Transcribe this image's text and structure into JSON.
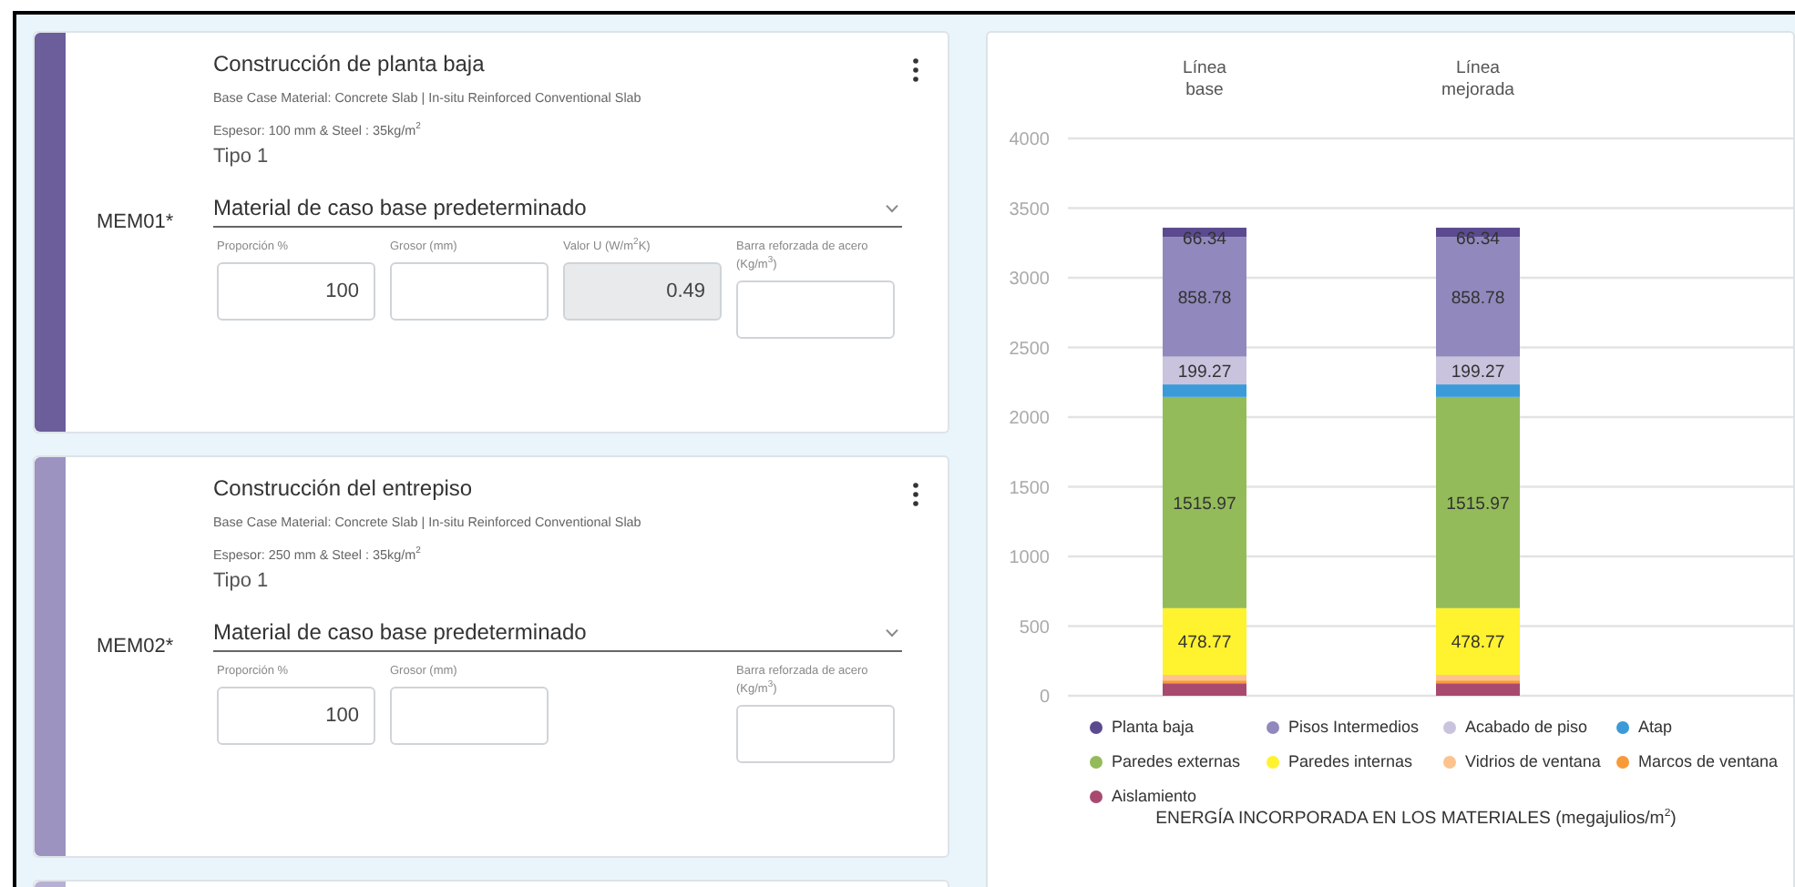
{
  "cards": [
    {
      "color": "#6b5e9b",
      "code": "MEM01*",
      "title": "Construcción de planta baja",
      "base_case": "Base Case Material: Concrete Slab | In-situ Reinforced Conventional Slab",
      "thickness": "Espesor: 100 mm & Steel : 35kg/m$^{2}$",
      "type": "Tipo 1",
      "material": "Material de caso base predeterminado",
      "fields": [
        {
          "kind": "number",
          "label": "Proporción %",
          "value": "100"
        },
        {
          "kind": "number",
          "label": "Grosor (mm)"
        },
        {
          "kind": "readonly",
          "label": "Valor U (W/m$^{2}$K)",
          "value": "0.49"
        },
        {
          "kind": "steel",
          "label": "Barra reforzada de acero (Kg/m$^{3}$)"
        }
      ]
    },
    {
      "color": "#9d93c0",
      "code": "MEM02*",
      "title": "Construcción del entrepiso",
      "base_case": "Base Case Material: Concrete Slab | In-situ Reinforced Conventional Slab",
      "thickness": "Espesor: 250 mm & Steel : 35kg/m$^{2}$",
      "type": "Tipo 1",
      "material": "Material de caso base predeterminado",
      "fields": [
        {
          "kind": "number",
          "label": "Proporción %",
          "value": "100"
        },
        {
          "kind": "number",
          "label": "Grosor (mm)"
        },
        {
          "kind": "steel",
          "label": "Barra reforzada de acero (Kg/m$^{3}$)"
        }
      ]
    },
    {
      "color": "#b7b0d3"
    }
  ],
  "chart": {
    "chart_data": {
      "type": "bar",
      "stacked": true,
      "grid": true,
      "legend": true,
      "title": "ENERGÍA INCORPORADA EN LOS MATERIALES (megajulios/m$^{2}$)",
      "categories": [
        "Línea\nbase",
        "Línea\nmejorada"
      ],
      "ylim": [
        0,
        4000
      ],
      "yticks": [
        0,
        500,
        1000,
        1500,
        2000,
        2500,
        3000,
        3500,
        4000
      ],
      "series": [
        {
          "name": "Planta baja",
          "color": "#5b4a8f",
          "values": [
            66.34,
            66.34
          ],
          "value_labels": [
            "66.34",
            "66.34"
          ]
        },
        {
          "name": "Pisos Intermedios",
          "color": "#9189bd",
          "values": [
            858.78,
            858.78
          ],
          "value_labels": [
            "858.78",
            "858.78"
          ]
        },
        {
          "name": "Acabado de piso",
          "color": "#c9c3de",
          "values": [
            199.27,
            199.27
          ],
          "value_labels": [
            "199.27",
            "199.27"
          ]
        },
        {
          "name": "Atap",
          "color": "#3a9bd8",
          "values": [
            90,
            90
          ],
          "value_labels": [
            null,
            null
          ]
        },
        {
          "name": "Paredes externas",
          "color": "#94bb5a",
          "values": [
            1515.97,
            1515.97
          ],
          "value_labels": [
            "1515.97",
            "1515.97"
          ]
        },
        {
          "name": "Paredes internas",
          "color": "#fff22e",
          "values": [
            478.77,
            478.77
          ],
          "value_labels": [
            "478.77",
            "478.77"
          ]
        },
        {
          "name": "Vidrios de ventana",
          "color": "#fcc38e",
          "values": [
            40,
            40
          ],
          "value_labels": [
            null,
            null
          ]
        },
        {
          "name": "Marcos de ventana",
          "color": "#f99a3a",
          "values": [
            20,
            20
          ],
          "value_labels": [
            null,
            null
          ]
        },
        {
          "name": "Aislamiento",
          "color": "#a84a70",
          "values": [
            90,
            90
          ],
          "value_labels": [
            null,
            null
          ]
        }
      ]
    }
  }
}
